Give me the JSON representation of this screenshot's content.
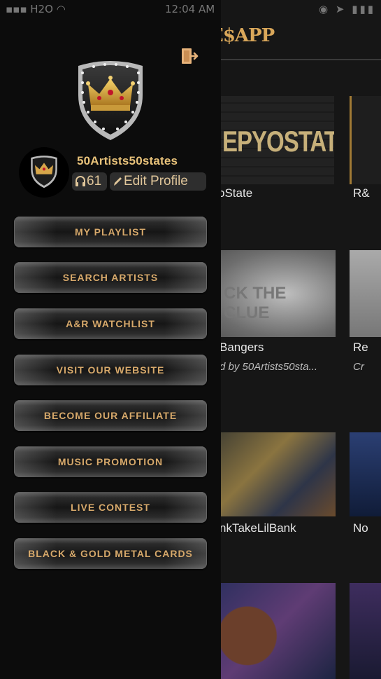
{
  "status_bar": {
    "carrier": "H2O",
    "time": "12:04 AM"
  },
  "background": {
    "app_title": "E$APP",
    "thumb_titles": [
      "EPYOSTATE",
      "CK THE CLUE"
    ],
    "cards": [
      {
        "title": "oState",
        "title2": "R&"
      },
      {
        "title": "Bangers",
        "title2": "Re",
        "subtitle": "d by 50Artists50sta...",
        "subtitle2": "Cr"
      },
      {
        "title": "nkTakeLilBank",
        "title2": "No"
      }
    ]
  },
  "drawer": {
    "username": "50Artists50states",
    "listen_count": "61",
    "edit_profile_label": "Edit Profile",
    "menu": [
      "MY PLAYLIST",
      "SEARCH ARTISTS",
      "A&R WATCHLIST",
      "VISIT OUR WEBSITE",
      "BECOME OUR AFFILIATE",
      "MUSIC PROMOTION",
      "LIVE CONTEST",
      "BLACK & GOLD METAL CARDS"
    ]
  },
  "colors": {
    "gold": "#d7a96b",
    "background": "#0c0c0c"
  },
  "icons": [
    "logout-icon",
    "headphones-icon",
    "pencil-icon",
    "crown-shield-logo"
  ]
}
